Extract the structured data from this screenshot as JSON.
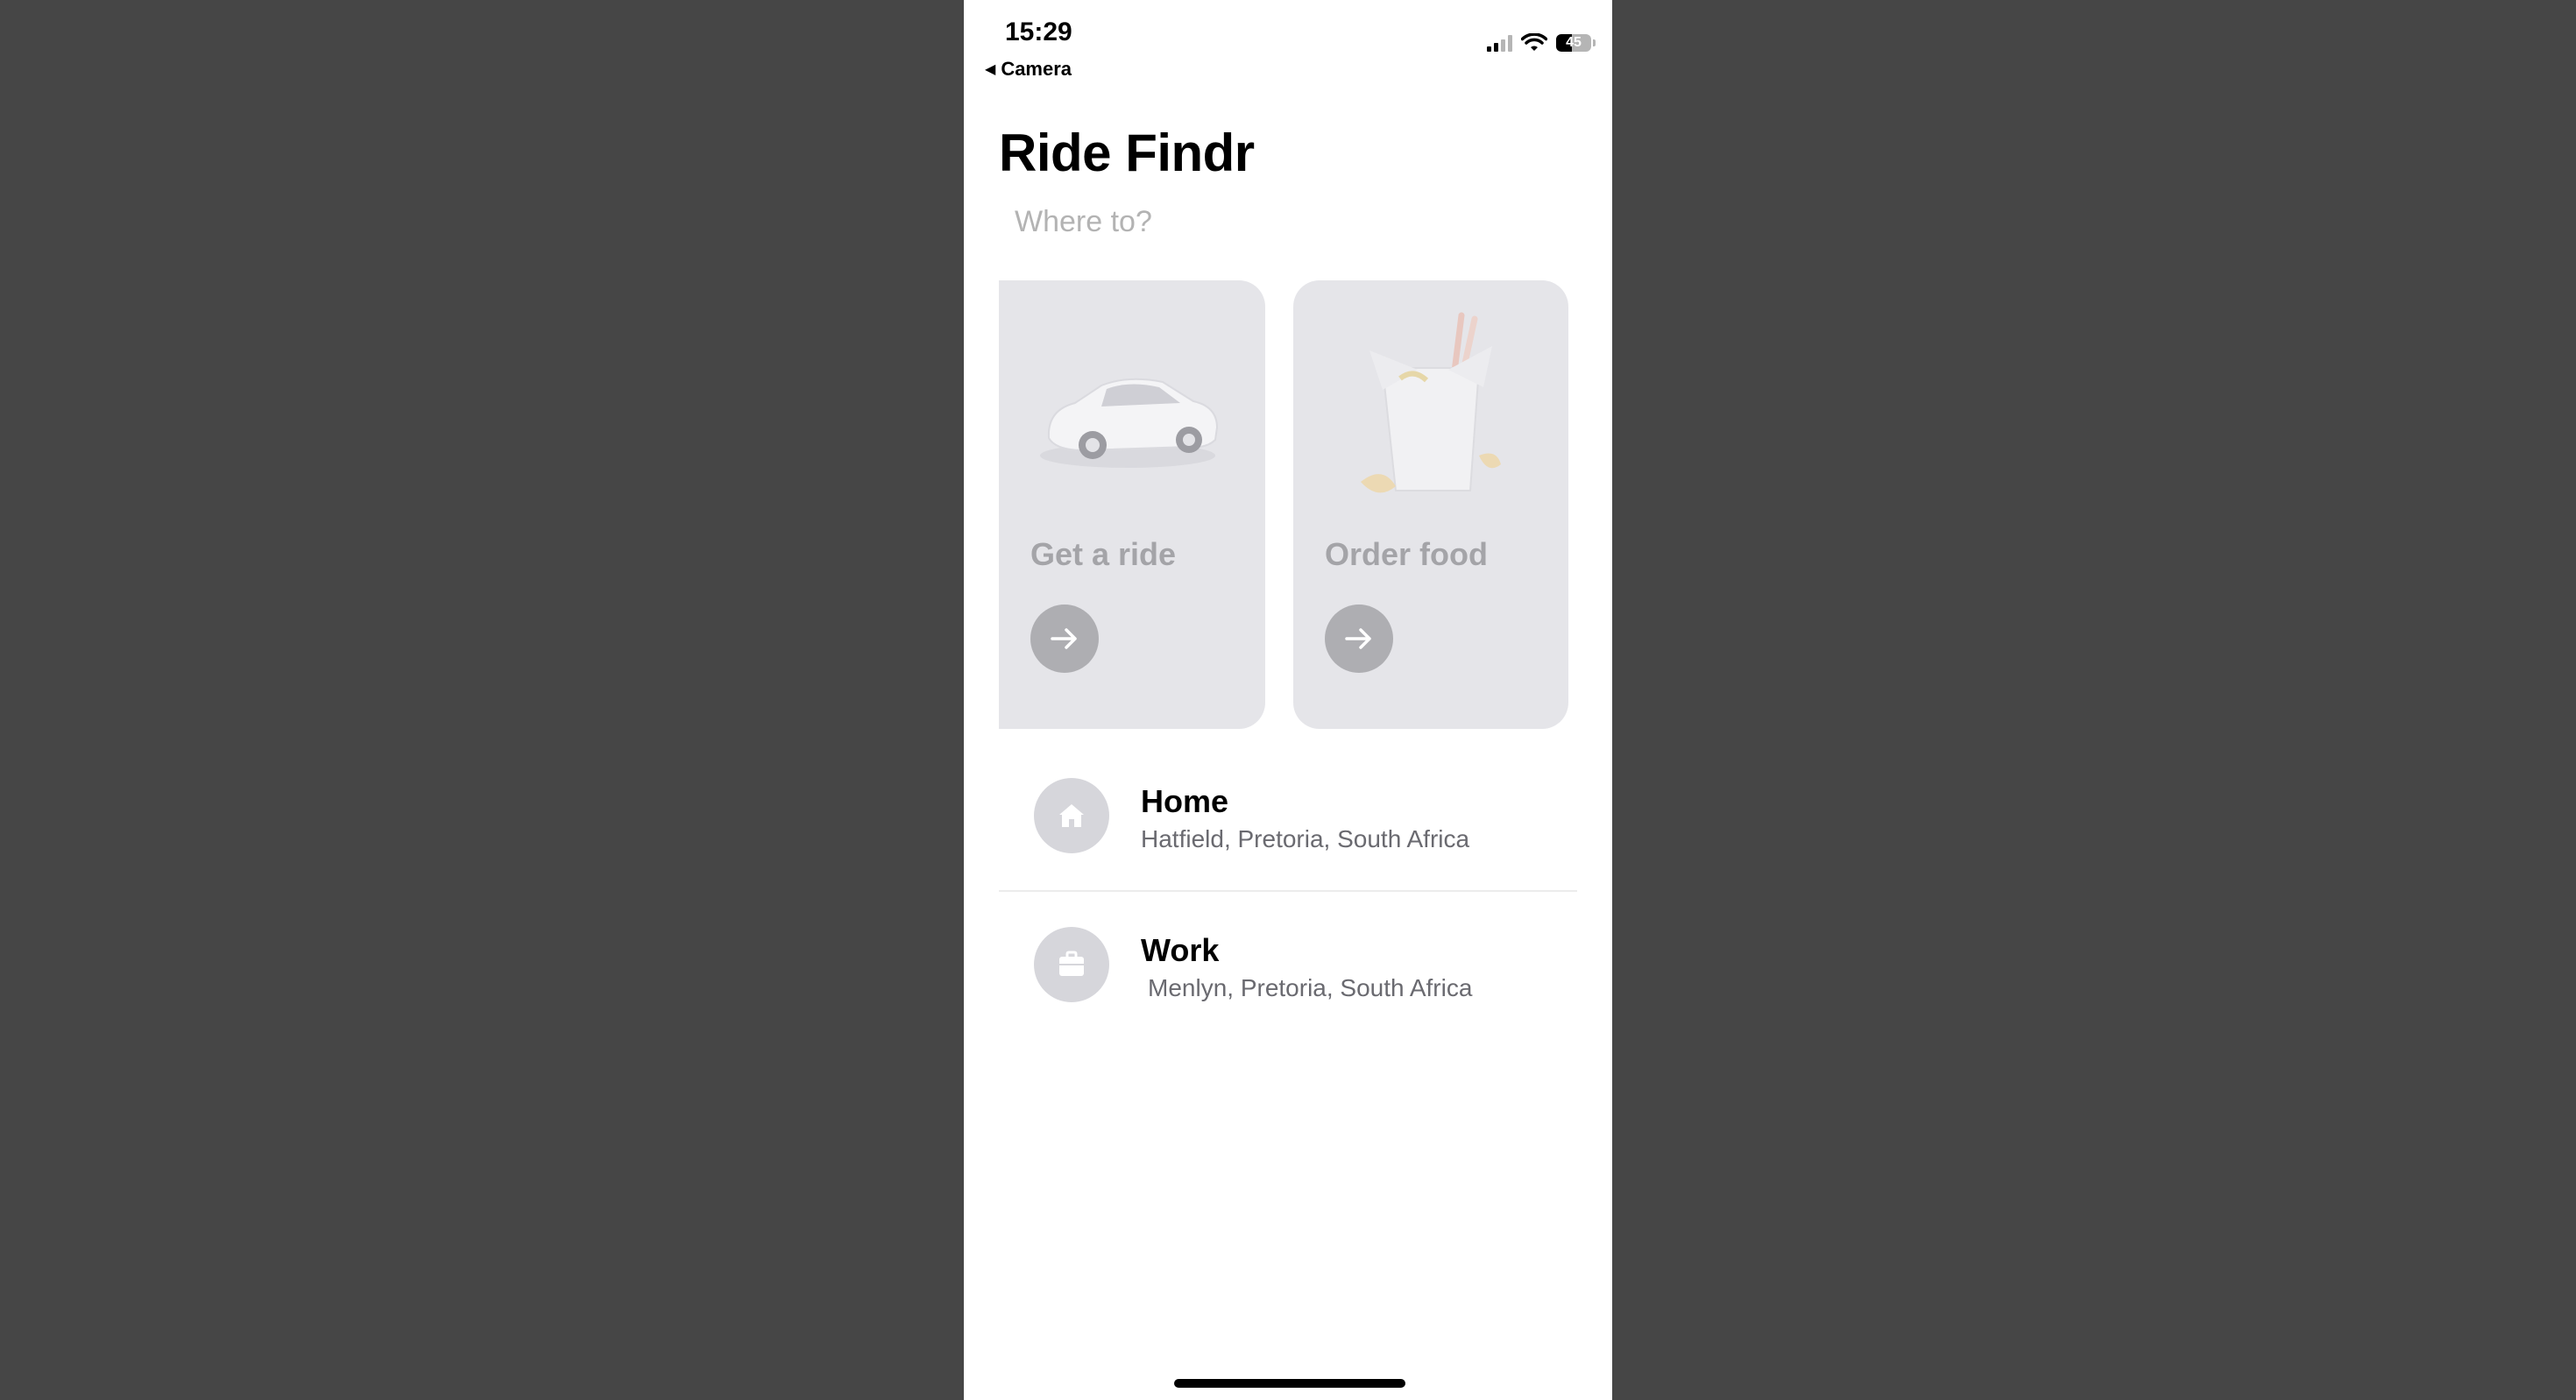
{
  "status_bar": {
    "time": "15:29",
    "back_label": "Camera",
    "battery_level": "45",
    "signal_bars_active": 2,
    "signal_bars_total": 4
  },
  "app": {
    "title": "Ride Findr",
    "search_placeholder": "Where to?"
  },
  "cards": [
    {
      "label": "Get a ride",
      "illustration": "car-icon"
    },
    {
      "label": "Order food",
      "illustration": "takeout-box-icon"
    }
  ],
  "saved_places": [
    {
      "name": "Home",
      "address": "Hatfield, Pretoria, South Africa",
      "icon": "house-icon"
    },
    {
      "name": "Work",
      "address": "Menlyn, Pretoria, South Africa",
      "icon": "briefcase-icon"
    }
  ],
  "colors": {
    "background": "#464646",
    "card": "#e5e5e9",
    "card_label": "#a4a4a8",
    "arrow_button": "#aeaeb2",
    "place_icon_bg": "#d6d6db"
  }
}
